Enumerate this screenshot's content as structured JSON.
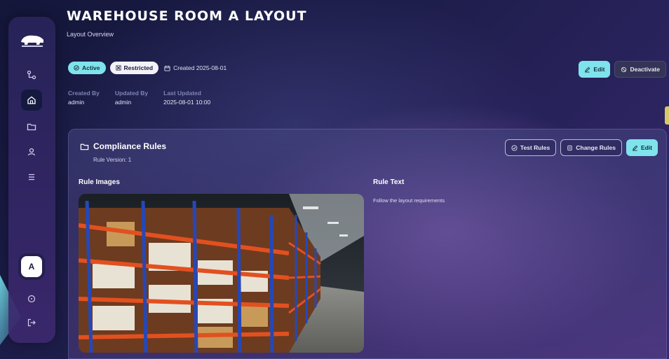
{
  "header": {
    "title": "Warehouse Room A Layout",
    "subtitle": "Layout Overview"
  },
  "badges": {
    "active": "Active",
    "restricted": "Restricted",
    "created": "Created 2025-08-01"
  },
  "meta": {
    "created_by_label": "Created By",
    "created_by_value": "admin",
    "updated_by_label": "Updated By",
    "updated_by_value": "admin",
    "last_updated_label": "Last Updated",
    "last_updated_value": "2025-08-01  10:00"
  },
  "top_actions": {
    "edit": "Edit",
    "deactivate": "Deactivate"
  },
  "sidebar": {
    "avatar_initial": "A",
    "items": [
      {
        "icon": "workflow-icon"
      },
      {
        "icon": "home-icon",
        "active": true
      },
      {
        "icon": "folder-icon"
      },
      {
        "icon": "user-icon"
      },
      {
        "icon": "list-icon"
      }
    ]
  },
  "card": {
    "title": "Compliance Rules",
    "subtitle": "Rule Version: 1",
    "test_rules": "Test Rules",
    "change_rules": "Change Rules",
    "edit": "Edit",
    "images_label": "Rule Images",
    "text_label": "Rule Text",
    "rule_text": "Follow the layout requirements"
  },
  "colors": {
    "accent": "#7fe3ec",
    "background": "#1d1d4a"
  }
}
